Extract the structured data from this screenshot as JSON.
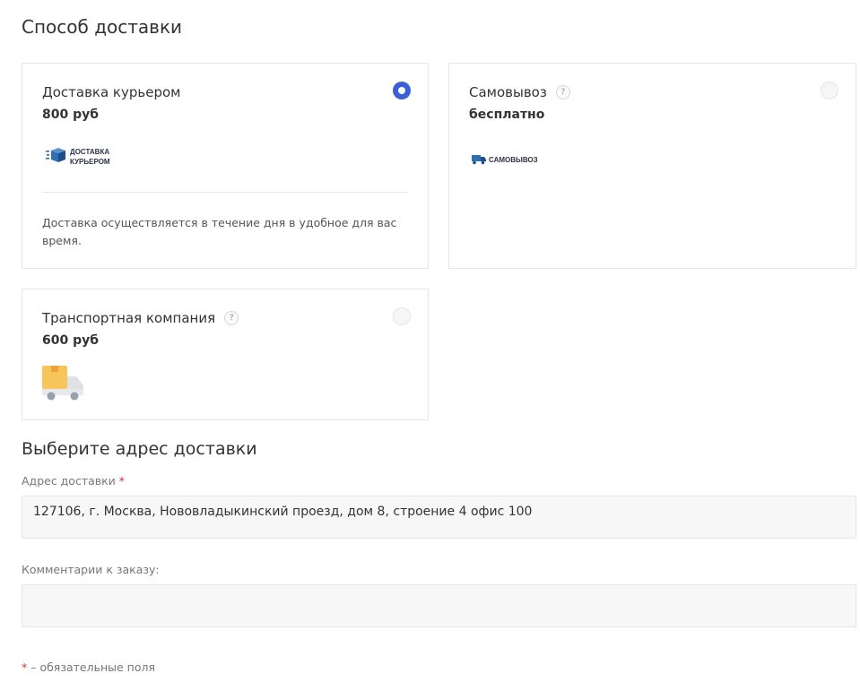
{
  "delivery_section": {
    "title": "Способ доставки"
  },
  "options": [
    {
      "name": "Доставка курьером",
      "price": "800 руб",
      "selected": true,
      "logo_lines": [
        "ДОСТАВКА",
        "КУРЬЕРОМ"
      ],
      "logo_icon": "box-icon",
      "description": "Доставка осуществляется в течение дня в удобное для вас время."
    },
    {
      "name": "Самовывоз",
      "help": "?",
      "price": "бесплатно",
      "selected": false,
      "logo_lines": [
        "САМОВЫВОЗ"
      ],
      "logo_icon": "truck-icon"
    },
    {
      "name": "Транспортная компания",
      "help": "?",
      "price": "600 руб",
      "selected": false,
      "logo_icon": "delivery-truck-icon"
    }
  ],
  "address_section": {
    "title": "Выберите адрес доставки",
    "address_label": "Адрес доставки",
    "required_mark": "*",
    "address_value": "127106, г. Москва, Нововладыкинский проезд, дом 8, строение 4 офис 100",
    "comment_label": "Комментарии к заказу:",
    "comment_value": ""
  },
  "footnote": {
    "mark": "*",
    "text": " – обязательные поля"
  },
  "colors": {
    "accent": "#3a5fd8",
    "required": "#d0312d",
    "field_bg": "#f7f7f7",
    "truck_box": "#f7c65a"
  }
}
